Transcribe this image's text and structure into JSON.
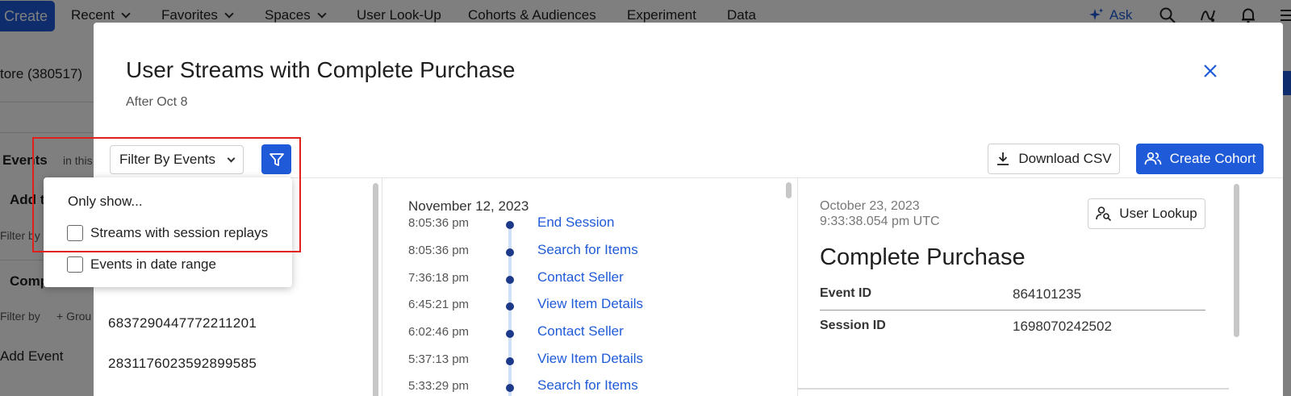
{
  "topnav": {
    "create_label": "Create",
    "items": [
      "Recent",
      "Favorites",
      "Spaces",
      "User Look-Up",
      "Cohorts & Audiences",
      "Experiment",
      "Data"
    ],
    "ask_label": "Ask"
  },
  "background": {
    "project_label": "tore (380517)",
    "events_label": "Events",
    "in_this_label": "in this",
    "add_label": "Add t",
    "filter_by_label_1": "Filter by",
    "comp_label": "Comp",
    "filter_by_label_2": "Filter by",
    "group_label": "+ Grou",
    "add_event_label": "Add Event"
  },
  "modal": {
    "title": "User Streams with Complete Purchase",
    "subtitle": "After Oct 8",
    "filter_select_label": "Filter By Events",
    "download_label": "Download CSV",
    "create_cohort_label": "Create Cohort"
  },
  "dropdown": {
    "heading": "Only show...",
    "options": [
      "Streams with session replays",
      "Events in date range"
    ]
  },
  "user_list": [
    "6837290447772211201",
    "2831176023592899585"
  ],
  "timeline": {
    "date": "November 12, 2023",
    "rows": [
      {
        "time": "8:05:36 pm",
        "event": "End Session"
      },
      {
        "time": "8:05:36 pm",
        "event": "Search for Items"
      },
      {
        "time": "7:36:18 pm",
        "event": "Contact Seller"
      },
      {
        "time": "6:45:21 pm",
        "event": "View Item Details"
      },
      {
        "time": "6:02:46 pm",
        "event": "Contact Seller"
      },
      {
        "time": "5:37:13 pm",
        "event": "View Item Details"
      },
      {
        "time": "5:33:29 pm",
        "event": "Search for Items"
      }
    ]
  },
  "detail": {
    "date_line1": "October 23, 2023",
    "date_line2": "9:33:38.054 pm UTC",
    "lookup_label": "User Lookup",
    "title": "Complete Purchase",
    "props": [
      {
        "key": "Event ID",
        "value": "864101235"
      },
      {
        "key": "Session ID",
        "value": "1698070242502"
      }
    ]
  },
  "colors": {
    "accent": "#1f5bd8",
    "highlight": "#e0201b",
    "timeline_dot": "#1d3a8a"
  }
}
